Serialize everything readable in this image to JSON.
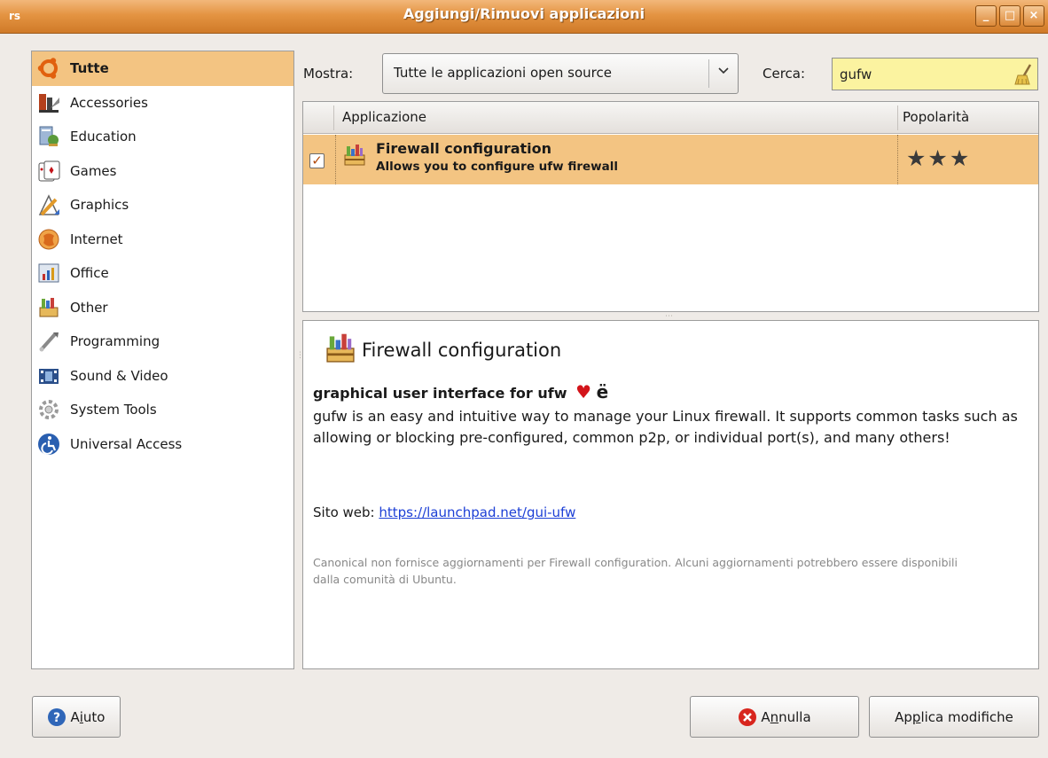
{
  "window": {
    "title": "Aggiungi/Rimuovi applicazioni",
    "appicon": "rs",
    "btn_min": "_",
    "btn_max": "□",
    "btn_close": "×"
  },
  "sidebar": {
    "items": [
      {
        "label": "Tutte",
        "icon": "ubuntu-logo-icon",
        "selected": true
      },
      {
        "label": "Accessories",
        "icon": "accessories-icon"
      },
      {
        "label": "Education",
        "icon": "education-icon"
      },
      {
        "label": "Games",
        "icon": "games-icon"
      },
      {
        "label": "Graphics",
        "icon": "graphics-icon"
      },
      {
        "label": "Internet",
        "icon": "internet-icon"
      },
      {
        "label": "Office",
        "icon": "office-icon"
      },
      {
        "label": "Other",
        "icon": "other-icon"
      },
      {
        "label": "Programming",
        "icon": "programming-icon"
      },
      {
        "label": "Sound & Video",
        "icon": "sound-video-icon"
      },
      {
        "label": "System Tools",
        "icon": "system-tools-icon"
      },
      {
        "label": "Universal Access",
        "icon": "universal-access-icon"
      }
    ]
  },
  "filter": {
    "show_label": "Mostra:",
    "show_value": "Tutte le applicazioni open source",
    "search_label": "Cerca:",
    "search_value": "gufw"
  },
  "table": {
    "col_app": "Applicazione",
    "col_popularity": "Popolarità",
    "rows": [
      {
        "checked": true,
        "check_glyph": "✓",
        "name": "Firewall configuration",
        "description": "Allows you to configure ufw firewall",
        "popularity_stars": 3,
        "stars": "★★★"
      }
    ]
  },
  "details": {
    "title": "Firewall configuration",
    "subtitle": "graphical user interface for ufw",
    "heart": "♥",
    "foot": "ë",
    "description": "gufw is an easy and intuitive way to manage your Linux firewall. It supports common tasks such as allowing or blocking pre-configured, common p2p, or individual port(s), and many others!",
    "website_label": "Sito web:",
    "website_url": "https://launchpad.net/gui-ufw",
    "note": "Canonical non fornisce aggiornamenti per Firewall configuration. Alcuni aggiornamenti potrebbero essere disponibili dalla comunità di Ubuntu."
  },
  "buttons": {
    "help_pre": "A",
    "help_mnemonic": "i",
    "help_post": "uto",
    "cancel_pre": "A",
    "cancel_mnemonic": "n",
    "cancel_post": "nulla",
    "apply_pre": "Ap",
    "apply_mnemonic": "p",
    "apply_post": "lica modifiche"
  },
  "colors": {
    "titlebar": "#e49442",
    "selection": "#f3c482",
    "search_bg": "#fbf3a0",
    "link": "#1c3fd6"
  }
}
